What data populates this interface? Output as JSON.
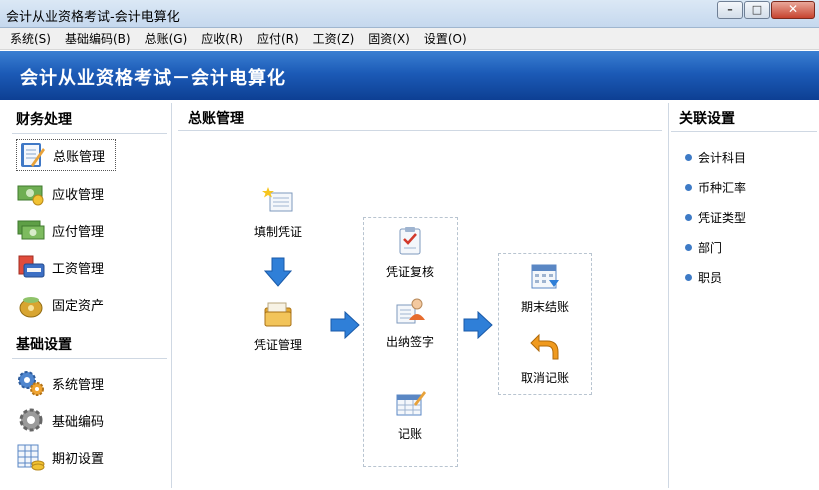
{
  "window": {
    "title": "会计从业资格考试-会计电算化",
    "minimize_glyph": "–",
    "maximize_glyph": "□",
    "close_glyph": "✕"
  },
  "menu": [
    "系统(S)",
    "基础编码(B)",
    "总账(G)",
    "应收(R)",
    "应付(R)",
    "工资(Z)",
    "固资(X)",
    "设置(O)"
  ],
  "banner": {
    "title": "会计从业资格考试－会计电算化"
  },
  "left": {
    "section1": "财务处理",
    "items1": [
      "总账管理",
      "应收管理",
      "应付管理",
      "工资管理",
      "固定资产"
    ],
    "section2": "基础设置",
    "items2": [
      "系统管理",
      "基础编码",
      "期初设置"
    ]
  },
  "center": {
    "title": "总账管理",
    "nodes": {
      "fill": "填制凭证",
      "manage": "凭证管理",
      "review": "凭证复核",
      "cashier": "出纳签字",
      "book": "记账",
      "close": "期末结账",
      "cancel": "取消记账"
    }
  },
  "right": {
    "title": "关联设置",
    "links": [
      "会计科目",
      "币种汇率",
      "凭证类型",
      "部门",
      "职员"
    ]
  },
  "colors": {
    "accent": "#1c5bb7",
    "arrow": "#2f7fd8",
    "bullet": "#3e7bc6"
  }
}
